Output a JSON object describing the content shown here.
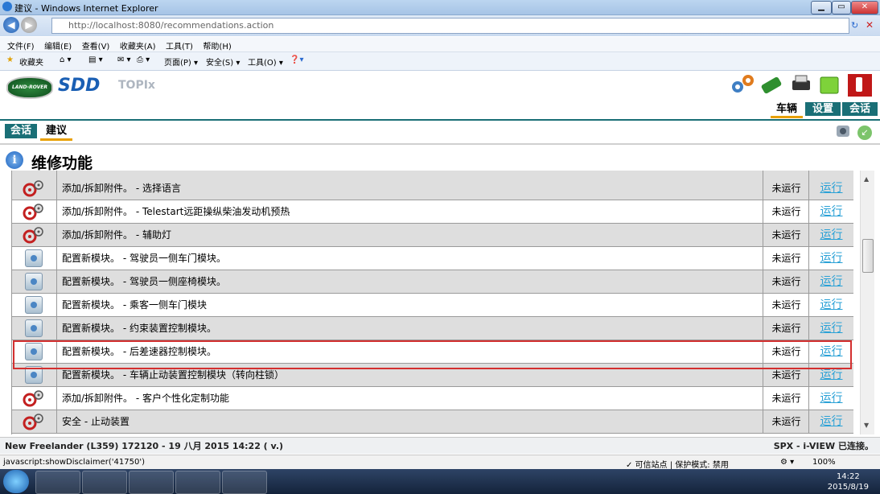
{
  "window": {
    "title": "建议 - Windows Internet Explorer"
  },
  "browser": {
    "url": "http://localhost:8080/recommendations.action",
    "menu": [
      "文件(F)",
      "编辑(E)",
      "查看(V)",
      "收藏夹(A)",
      "工具(T)",
      "帮助(H)"
    ],
    "favorites_label": "收藏夹",
    "toolbar": {
      "page": "页面(P) ▾",
      "safety": "安全(S) ▾",
      "tools": "工具(O) ▾"
    }
  },
  "app": {
    "logo": "LAND-ROVER",
    "brand": "SDD",
    "product": "TOPIx",
    "top_tabs": [
      "车辆",
      "设置",
      "会话"
    ],
    "sub_tabs": [
      "会话",
      "建议"
    ],
    "page_title": "维修功能"
  },
  "rows": [
    {
      "icon": "gear-icon",
      "desc": "添加/拆卸附件。 - 选择语言",
      "status": "未运行",
      "action": "运行"
    },
    {
      "icon": "gear-icon",
      "desc": "添加/拆卸附件。 - Telestart远距操纵柴油发动机预热",
      "status": "未运行",
      "action": "运行"
    },
    {
      "icon": "gear-icon",
      "desc": "添加/拆卸附件。 - 辅助灯",
      "status": "未运行",
      "action": "运行"
    },
    {
      "icon": "module-icon",
      "desc": "配置新模块。 - 驾驶员一侧车门模块。",
      "status": "未运行",
      "action": "运行"
    },
    {
      "icon": "module-icon",
      "desc": "配置新模块。 - 驾驶员一侧座椅模块。",
      "status": "未运行",
      "action": "运行"
    },
    {
      "icon": "module-icon",
      "desc": "配置新模块。 - 乘客一侧车门模块",
      "status": "未运行",
      "action": "运行"
    },
    {
      "icon": "module-icon",
      "desc": "配置新模块。 - 约束装置控制模块。",
      "status": "未运行",
      "action": "运行"
    },
    {
      "icon": "module-icon",
      "desc": "配置新模块。 - 后差速器控制模块。",
      "status": "未运行",
      "action": "运行"
    },
    {
      "icon": "module-icon",
      "desc": "配置新模块。 - 车辆止动装置控制模块（转向柱锁）",
      "status": "未运行",
      "action": "运行"
    },
    {
      "icon": "gear-icon",
      "desc": "添加/拆卸附件。 - 客户个性化定制功能",
      "status": "未运行",
      "action": "运行"
    },
    {
      "icon": "gear-icon",
      "desc": "安全 - 止动装置",
      "status": "未运行",
      "action": "运行"
    }
  ],
  "vehicle_info": "New Freelander (L359) 172120 - 19 八月 2015 14:22 ( v.)",
  "connection": "SPX - i-VIEW 已连接。",
  "statusbar": {
    "link": "javascript:showDisclaimer('41750')",
    "zone": "✓ 可信站点 | 保护模式: 禁用",
    "zoom": "100%"
  },
  "clock": {
    "time": "14:22",
    "date": "2015/8/19"
  },
  "colors": {
    "accent": "#1a6f76",
    "link": "#2aa1d6",
    "highlight": "#d32f2f"
  }
}
